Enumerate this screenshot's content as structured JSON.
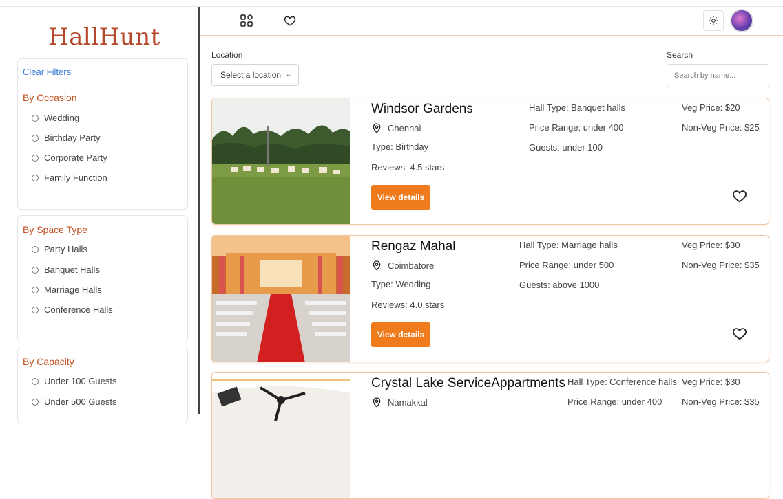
{
  "sidebar": {
    "logo": "HallHunt",
    "clear_filters": "Clear Filters",
    "groups": [
      {
        "title": "By Occasion",
        "options": [
          "Wedding",
          "Birthday Party",
          "Corporate Party",
          "Family Function"
        ]
      },
      {
        "title": "By Space Type",
        "options": [
          "Party Halls",
          "Banquet Halls",
          "Marriage Halls",
          "Conference Halls"
        ]
      },
      {
        "title": "By Capacity",
        "options": [
          "Under 100 Guests",
          "Under 500 Guests"
        ]
      }
    ]
  },
  "topbar": {
    "icons": [
      "grid-icon",
      "heart-icon",
      "sun-icon",
      "avatar"
    ]
  },
  "filters": {
    "location_label": "Location",
    "location_value": "Select a location",
    "search_label": "Search",
    "search_placeholder": "Search by name..."
  },
  "halls": [
    {
      "name": "Windsor Gardens",
      "location": "Chennai",
      "type": "Type: Birthday",
      "reviews": "Reviews: 4.5 stars",
      "hall_type": "Hall Type: Banquet halls",
      "price_range": "Price Range: under 400",
      "guests": "Guests: under 100",
      "veg_price": "Veg Price: $20",
      "nonveg_price": "Non-Veg Price: $25",
      "button": "View details"
    },
    {
      "name": "Rengaz Mahal",
      "location": "Coimbatore",
      "type": "Type: Wedding",
      "reviews": "Reviews: 4.0 stars",
      "hall_type": "Hall Type: Marriage halls",
      "price_range": "Price Range: under 500",
      "guests": "Guests: above 1000",
      "veg_price": "Veg Price: $30",
      "nonveg_price": "Non-Veg Price: $35",
      "button": "View details"
    },
    {
      "name": "Crystal Lake ServiceAppartments",
      "location": "Namakkal",
      "hall_type": "Hall Type: Conference halls",
      "price_range": "Price Range: under 400",
      "veg_price": "Veg Price: $30",
      "nonveg_price": "Non-Veg Price: $35"
    }
  ],
  "colors": {
    "accent": "#f07b1d",
    "logo": "#b5472a",
    "group_title": "#c0501f",
    "link": "#3a7bd5"
  }
}
